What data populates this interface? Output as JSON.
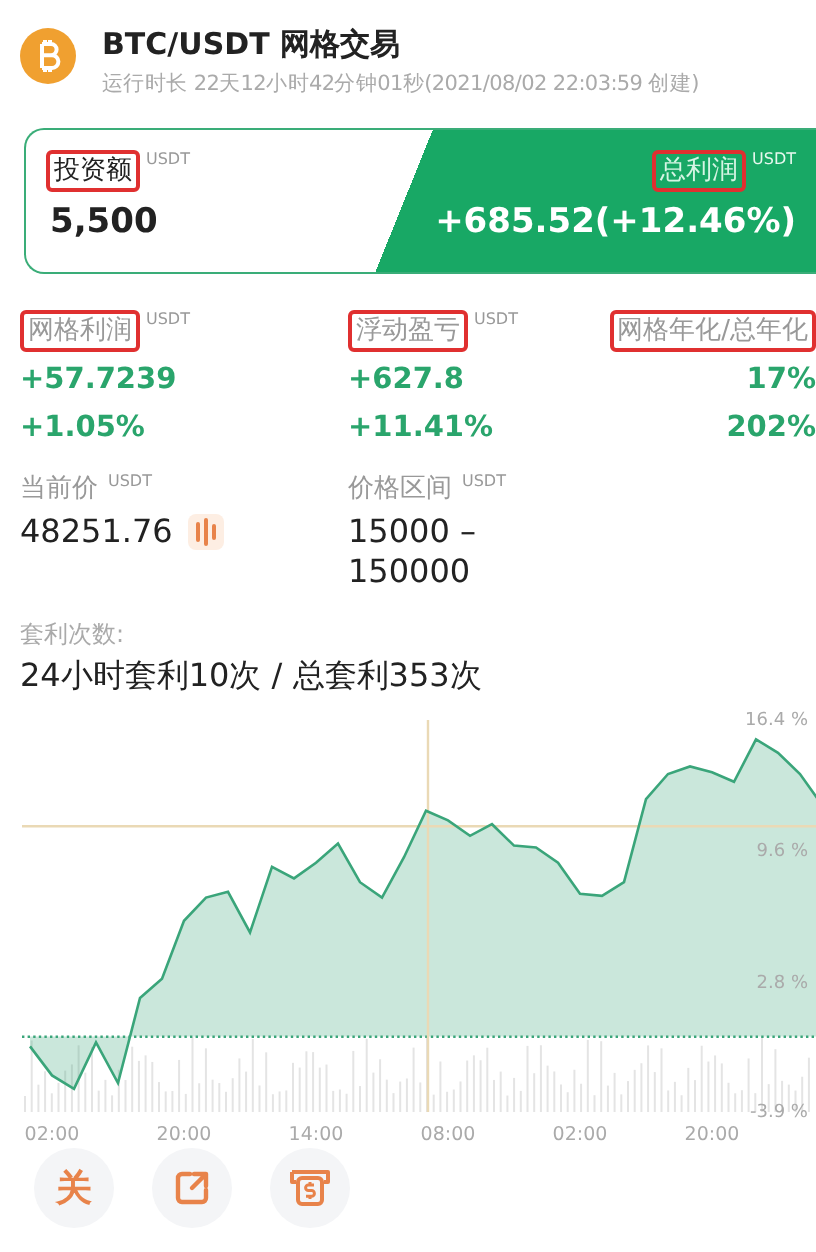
{
  "header": {
    "title": "BTC/USDT 网格交易",
    "subtitle": "运行时长 22天12小时42分钟01秒(2021/08/02 22:03:59 创建)"
  },
  "summary": {
    "investment": {
      "label": "投资额",
      "unit": "USDT",
      "value": "5,500",
      "highlighted": true
    },
    "profit": {
      "label": "总利润",
      "unit": "USDT",
      "value": "+685.52(+12.46%)",
      "highlighted": true
    }
  },
  "profit_stats": [
    {
      "label": "网格利润",
      "unit": "USDT",
      "highlighted": true,
      "values": [
        "+57.7239",
        "+1.05%"
      ]
    },
    {
      "label": "浮动盈亏",
      "unit": "USDT",
      "highlighted": true,
      "values": [
        "+627.8",
        "+11.41%"
      ]
    },
    {
      "label": "网格年化/总年化",
      "highlighted": true,
      "values": [
        "17%",
        "202%"
      ]
    }
  ],
  "price_stats": [
    {
      "label": "当前价",
      "unit": "USDT",
      "value": "48251.76",
      "kind": "live"
    },
    {
      "label": "价格区间",
      "unit": "USDT",
      "value": "15000 – 150000",
      "kind": "plain"
    }
  ],
  "arbitrage": {
    "label": "套利次数:",
    "value": "24小时套利10次 / 总套利353次"
  },
  "chart": {
    "chart_data": {
      "type": "area",
      "categories": [
        null,
        "02:00",
        null,
        null,
        null,
        null,
        null,
        "20:00",
        null,
        null,
        null,
        null,
        null,
        "14:00",
        null,
        null,
        null,
        null,
        null,
        "08:00",
        null,
        null,
        null,
        null,
        null,
        "02:00",
        null,
        null,
        null,
        null,
        null,
        "20:00",
        null,
        null,
        null,
        null,
        null
      ],
      "series": [
        {
          "color": "#3aa57a",
          "values": [
            -0.5,
            -2.0,
            -2.7,
            -0.3,
            -2.4,
            2.0,
            3.0,
            6.0,
            7.2,
            7.5,
            5.4,
            8.8,
            8.2,
            9.0,
            10.0,
            8.0,
            7.2,
            9.3,
            11.7,
            11.2,
            10.4,
            11.0,
            9.9,
            9.8,
            9.0,
            7.4,
            7.3,
            8.0,
            12.3,
            13.6,
            14.0,
            13.7,
            13.2,
            15.4,
            14.7,
            13.6,
            12.0
          ]
        }
      ],
      "ylim": [
        -3.9,
        16.4
      ],
      "ref_lines": [
        {
          "axis": "y",
          "value": 0
        },
        {
          "axis": "y",
          "value": 10.9
        }
      ],
      "yticks": [
        {
          "value": 16.4,
          "label": "16.4 %"
        },
        {
          "value": 9.6,
          "label": "9.6 %"
        },
        {
          "value": 2.8,
          "label": "2.8 %"
        },
        {
          "value": -3.9,
          "label": "-3.9 %"
        }
      ]
    }
  },
  "actions": [
    {
      "kind": "glyph",
      "label": "关"
    },
    {
      "kind": "share"
    },
    {
      "kind": "cashier"
    }
  ]
}
